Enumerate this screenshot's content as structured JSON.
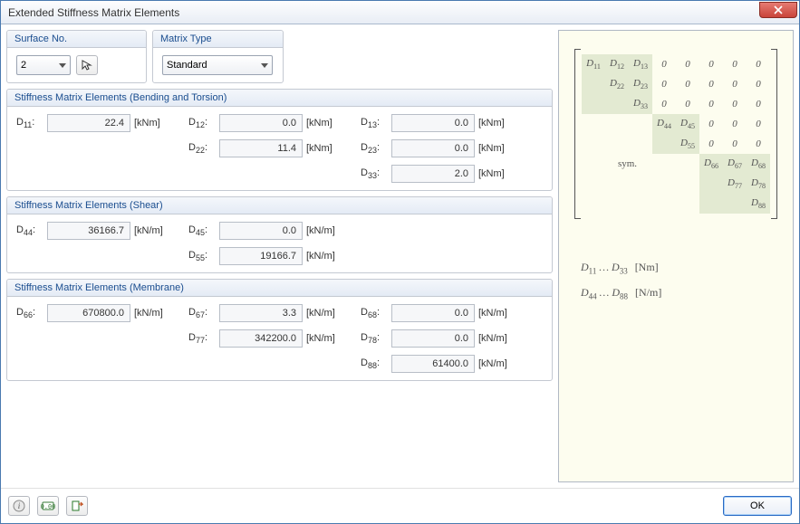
{
  "window": {
    "title": "Extended Stiffness Matrix Elements"
  },
  "surface": {
    "label": "Surface No.",
    "value": "2"
  },
  "matrix_type": {
    "label": "Matrix Type",
    "value": "Standard"
  },
  "groups": {
    "bending": {
      "title": "Stiffness Matrix Elements (Bending and Torsion)",
      "d11": {
        "label": "D11:",
        "value": "22.4",
        "unit": "[kNm]"
      },
      "d12": {
        "label": "D12:",
        "value": "0.0",
        "unit": "[kNm]"
      },
      "d13": {
        "label": "D13:",
        "value": "0.0",
        "unit": "[kNm]"
      },
      "d22": {
        "label": "D22:",
        "value": "11.4",
        "unit": "[kNm]"
      },
      "d23": {
        "label": "D23:",
        "value": "0.0",
        "unit": "[kNm]"
      },
      "d33": {
        "label": "D33:",
        "value": "2.0",
        "unit": "[kNm]"
      }
    },
    "shear": {
      "title": "Stiffness Matrix Elements (Shear)",
      "d44": {
        "label": "D44:",
        "value": "36166.7",
        "unit": "[kN/m]"
      },
      "d45": {
        "label": "D45:",
        "value": "0.0",
        "unit": "[kN/m]"
      },
      "d55": {
        "label": "D55:",
        "value": "19166.7",
        "unit": "[kN/m]"
      }
    },
    "membrane": {
      "title": "Stiffness Matrix Elements (Membrane)",
      "d66": {
        "label": "D66:",
        "value": "670800.0",
        "unit": "[kN/m]"
      },
      "d67": {
        "label": "D67:",
        "value": "3.3",
        "unit": "[kN/m]"
      },
      "d68": {
        "label": "D68:",
        "value": "0.0",
        "unit": "[kN/m]"
      },
      "d77": {
        "label": "D77:",
        "value": "342200.0",
        "unit": "[kN/m]"
      },
      "d78": {
        "label": "D78:",
        "value": "0.0",
        "unit": "[kN/m]"
      },
      "d88": {
        "label": "D88:",
        "value": "61400.0",
        "unit": "[kN/m]"
      }
    }
  },
  "matrix_panel": {
    "sym": "sym.",
    "legend1_left": "D11 … D33",
    "legend1_right": "[Nm]",
    "legend2_left": "D44 … D88",
    "legend2_right": "[N/m]"
  },
  "footer": {
    "ok": "OK"
  }
}
